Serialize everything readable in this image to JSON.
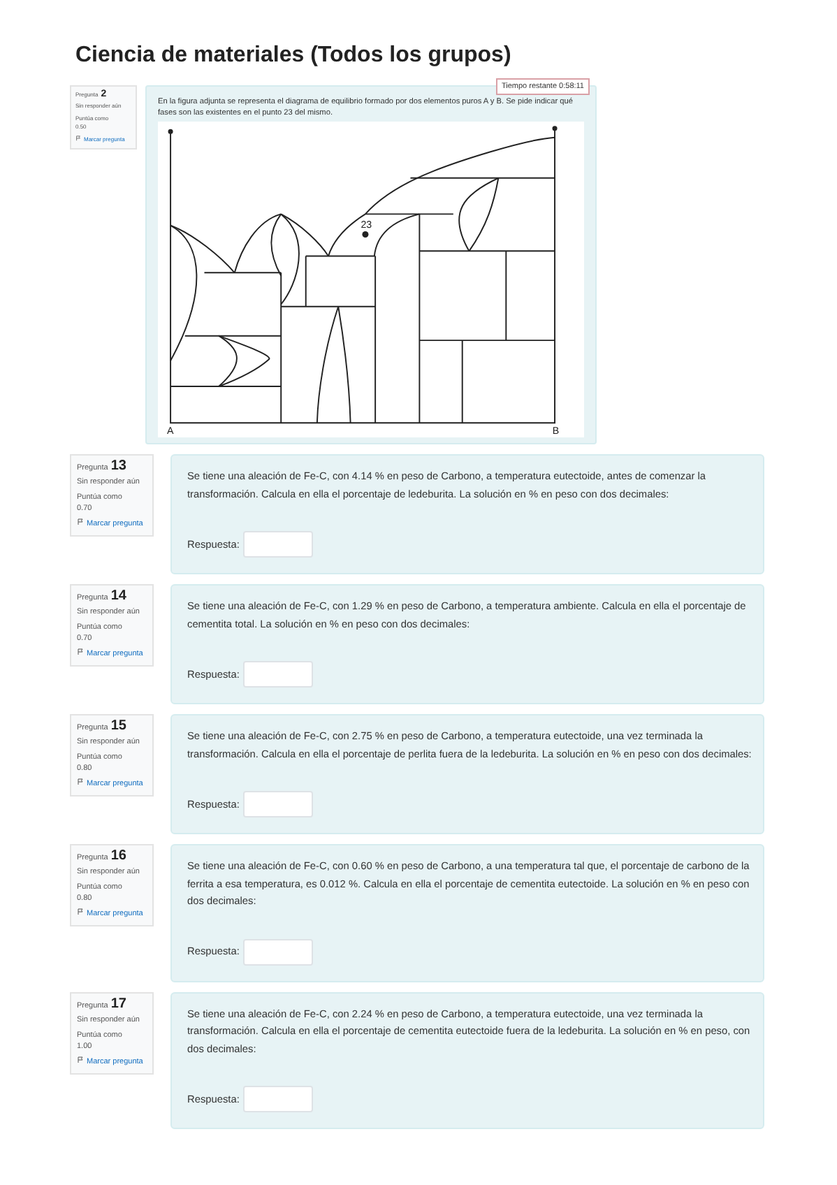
{
  "page_title": "Ciencia de materiales (Todos los grupos)",
  "timer": "Tiempo restante 0:58:11",
  "questions": [
    {
      "kind": "diagram",
      "label": "Pregunta",
      "number": "2",
      "status": "Sin responder aún",
      "points_label": "Puntúa como",
      "points": "0.50",
      "flag": "Marcar pregunta",
      "text": "En la figura adjunta se representa el diagrama de equilibrio formado por dos elementos puros A y B. Se pide indicar qué fases son las existentes en el punto 23 del mismo.",
      "diagram_labels": {
        "point": "23",
        "left": "A",
        "right": "B"
      }
    },
    {
      "kind": "answer",
      "label": "Pregunta",
      "number": "13",
      "status": "Sin responder aún",
      "points_label": "Puntúa como",
      "points": "0.70",
      "flag": "Marcar pregunta",
      "text": "Se tiene una aleación de Fe-C, con 4.14 % en peso de Carbono, a temperatura eutectoide, antes de comenzar la transformación. Calcula en ella el porcentaje de ledeburita. La solución en % en peso con dos decimales:",
      "answer_label": "Respuesta:"
    },
    {
      "kind": "answer",
      "label": "Pregunta",
      "number": "14",
      "status": "Sin responder aún",
      "points_label": "Puntúa como",
      "points": "0.70",
      "flag": "Marcar pregunta",
      "text": "Se tiene una aleación de Fe-C, con 1.29 % en peso de Carbono, a temperatura ambiente. Calcula en ella el porcentaje de cementita total. La solución en % en peso con dos decimales:",
      "answer_label": "Respuesta:"
    },
    {
      "kind": "answer",
      "label": "Pregunta",
      "number": "15",
      "status": "Sin responder aún",
      "points_label": "Puntúa como",
      "points": "0.80",
      "flag": "Marcar pregunta",
      "text": "Se tiene una aleación de Fe-C, con 2.75 % en peso de Carbono, a temperatura eutectoide, una vez terminada la transformación. Calcula en ella el porcentaje de perlita fuera de la ledeburita. La solución en % en peso con dos decimales:",
      "answer_label": "Respuesta:"
    },
    {
      "kind": "answer",
      "label": "Pregunta",
      "number": "16",
      "status": "Sin responder aún",
      "points_label": "Puntúa como",
      "points": "0.80",
      "flag": "Marcar pregunta",
      "text": "Se tiene una aleación de Fe-C, con 0.60 % en peso de Carbono, a una temperatura tal que, el porcentaje de carbono de la ferrita a esa temperatura, es 0.012 %. Calcula en ella el porcentaje de cementita eutectoide. La solución en % en peso con dos decimales:",
      "answer_label": "Respuesta:"
    },
    {
      "kind": "answer",
      "label": "Pregunta",
      "number": "17",
      "status": "Sin responder aún",
      "points_label": "Puntúa como",
      "points": "1.00",
      "flag": "Marcar pregunta",
      "text": "Se tiene una aleación de Fe-C, con 2.24 % en peso de Carbono, a temperatura eutectoide, una vez terminada la transformación. Calcula en ella el porcentaje de cementita eutectoide fuera de la ledeburita. La solución en % en peso, con dos decimales:",
      "answer_label": "Respuesta:"
    }
  ]
}
